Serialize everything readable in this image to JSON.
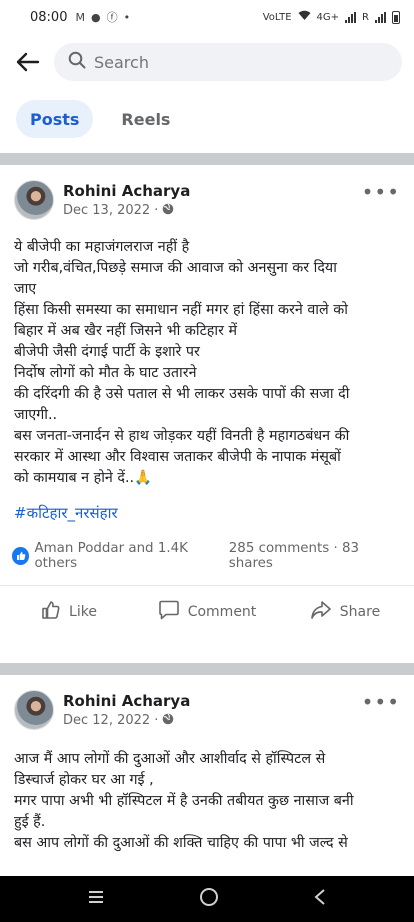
{
  "status_bar": {
    "time": "08:00",
    "left_icons": [
      "gmail-icon",
      "dot-icon",
      "facebook-icon",
      "dot-small-icon"
    ],
    "network": "4G+",
    "volte": "VoLTE",
    "roaming": "R"
  },
  "header": {
    "search_placeholder": "Search"
  },
  "tabs": [
    {
      "label": "Posts",
      "active": true
    },
    {
      "label": "Reels",
      "active": false
    }
  ],
  "posts": [
    {
      "author": "Rohini Acharya",
      "date": "Dec 13, 2022 ·",
      "lines": [
        "ये बीजेपी का महाजंगलराज नहीं है",
        "जो गरीब,वंचित,पिछड़े समाज की आवाज को अनसुना कर दिया",
        "जाए",
        "हिंसा किसी समस्या का समाधान नहीं मगर हां हिंसा करने वाले को",
        "बिहार में अब खैर नहीं जिसने भी कटिहार में",
        "बीजेपी जैसी दंगाई पार्टी के इशारे पर",
        "निर्दोष लोगों को मौत के घाट उतारने",
        "की दरिंदगी की है उसे पताल से भी लाकर उसके पापों की सजा दी",
        "जाएगी..",
        "बस जनता-जनार्दन से हाथ जोड़कर यहीं विनती है महागठबंधन की",
        "सरकार में आस्था और विश्वास जताकर बीजेपी के नापाक मंसूबों",
        "को कामयाब न होने दें..🙏"
      ],
      "hashtag": "#कटिहार_नरसंहार",
      "reactions_text": "Aman Poddar and 1.4K others",
      "comments_shares": "285 comments · 83 shares",
      "actions": {
        "like": "Like",
        "comment": "Comment",
        "share": "Share"
      }
    },
    {
      "author": "Rohini Acharya",
      "date": "Dec 12, 2022 ·",
      "lines": [
        "आज मैं आप लोगों की दुआओं और आशीर्वाद से हॉस्पिटल से",
        "डिस्चार्ज होकर घर आ गई ,",
        "मगर पापा अभी भी हॉस्पिटल में है उनकी तबीयत कुछ नासाज बनी",
        "हुई हैं.",
        "बस आप लोगों की दुआओं की शक्ति चाहिए की पापा भी जल्द से"
      ]
    }
  ],
  "colors": {
    "accent": "#1b5fcf",
    "tab_active_bg": "#e7f0fb",
    "divider": "#c9cccf"
  }
}
